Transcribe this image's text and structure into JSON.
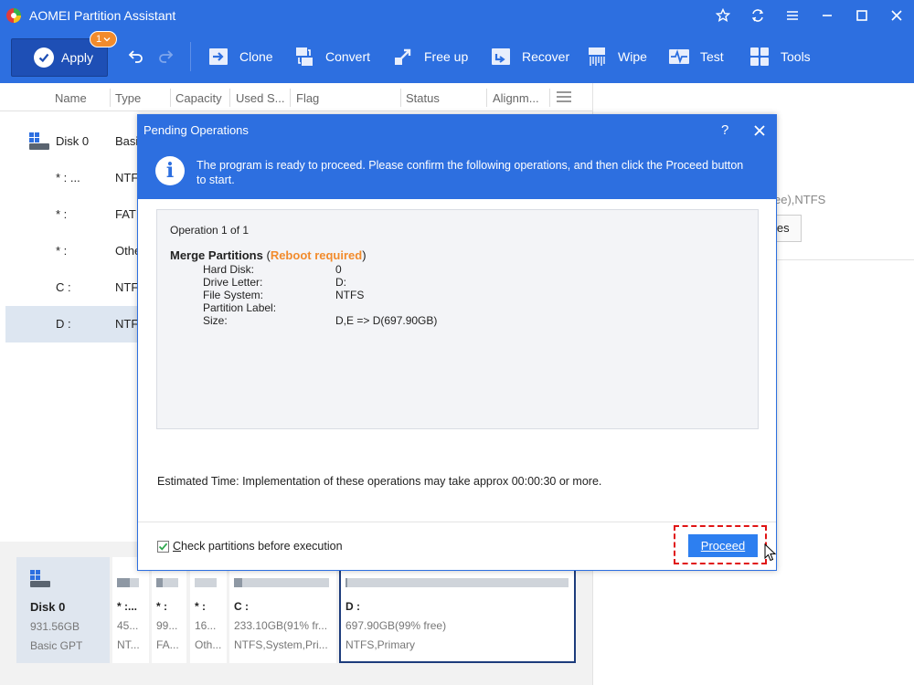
{
  "app": {
    "title": "AOMEI Partition Assistant"
  },
  "toolbar": {
    "apply_label": "Apply",
    "apply_badge": "1",
    "items": [
      "Clone",
      "Convert",
      "Free up",
      "Recover",
      "Wipe",
      "Test",
      "Tools"
    ]
  },
  "columns": [
    "Name",
    "Type",
    "Capacity",
    "Used S...",
    "Flag",
    "Status",
    "Alignm..."
  ],
  "rows": [
    {
      "name": "Disk 0",
      "type": "Basi"
    },
    {
      "name": "* : ...",
      "type": "NTF"
    },
    {
      "name": "* :",
      "type": "FAT"
    },
    {
      "name": "* :",
      "type": "Othe"
    },
    {
      "name": "C :",
      "type": "NTF"
    },
    {
      "name": "D :",
      "type": "NTF"
    }
  ],
  "right_pane": {
    "fs_text": "ee),NTFS",
    "btn_text": "ies"
  },
  "diskmap": {
    "disk": {
      "name": "Disk 0",
      "size": "931.56GB",
      "type": "Basic GPT"
    },
    "partitions": [
      {
        "name": "* :...",
        "size": "45...",
        "fs": "NT...",
        "used": 0.6
      },
      {
        "name": "* :",
        "size": "99...",
        "fs": "FA...",
        "used": 0.3
      },
      {
        "name": "* :",
        "size": "16...",
        "fs": "Oth...",
        "used": 0.0
      },
      {
        "name": "C :",
        "size": "233.10GB(91% fr...",
        "fs": "NTFS,System,Pri...",
        "used": 0.09
      },
      {
        "name": "D :",
        "size": "697.90GB(99% free)",
        "fs": "NTFS,Primary",
        "used": 0.01
      }
    ]
  },
  "dialog": {
    "title": "Pending Operations",
    "help": "?",
    "message": "The program is ready to proceed. Please confirm the following operations,  and then click the Proceed button to start.",
    "op_count": "Operation 1 of 1",
    "op_name": "Merge Partitions",
    "op_paren_open": "  (",
    "op_reboot": "Reboot required",
    "op_paren_close": ")",
    "details": [
      {
        "k": "Hard Disk:",
        "v": "0"
      },
      {
        "k": "Drive Letter:",
        "v": "D:"
      },
      {
        "k": "File System:",
        "v": "NTFS"
      },
      {
        "k": "Partition Label:",
        "v": ""
      },
      {
        "k": "Size:",
        "v": "D,E => D(697.90GB)"
      }
    ],
    "estimated": "Estimated Time: Implementation of these operations may take approx 00:00:30 or more.",
    "check_label": "Check partitions before execution",
    "check_underline": "C",
    "check_rest": "heck partitions before execution",
    "checked": true,
    "proceed": "Proceed"
  },
  "colors": {
    "blue": "#2d6fe0",
    "orange": "#f28b2c",
    "highlight": "#e01414"
  }
}
